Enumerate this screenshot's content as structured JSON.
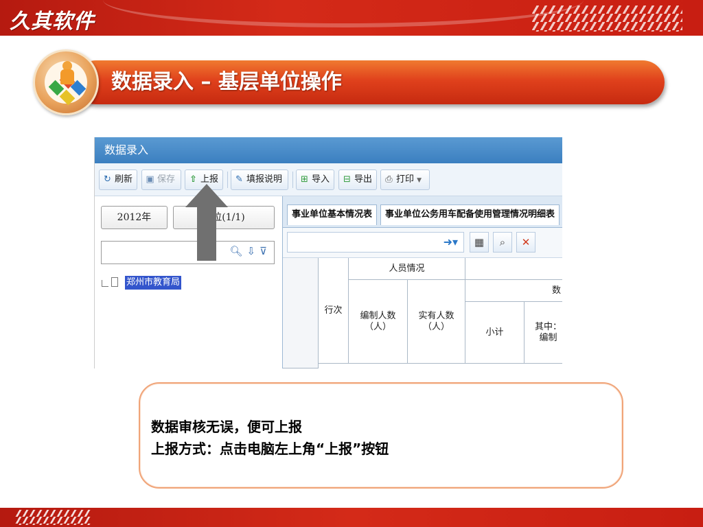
{
  "brand": {
    "logo_text": "久其软件",
    "primary_color": "#c81e12",
    "accent_color": "#e0411c"
  },
  "header": {
    "title": "数据录入 – 基层单位操作",
    "badge_icon": "colored-cubes-person-icon"
  },
  "screenshot": {
    "window_title": "数据录入",
    "toolbar": [
      {
        "label": "刷新",
        "icon": "refresh-icon",
        "enabled": true
      },
      {
        "label": "保存",
        "icon": "save-icon",
        "enabled": false
      },
      {
        "label": "上报",
        "icon": "upload-arrow-icon",
        "enabled": true
      },
      {
        "label": "填报说明",
        "icon": "edit-note-icon",
        "enabled": true
      },
      {
        "label": "导入",
        "icon": "import-icon",
        "enabled": true
      },
      {
        "label": "导出",
        "icon": "export-icon",
        "enabled": true
      },
      {
        "label": "打印",
        "icon": "print-icon",
        "enabled": true
      }
    ],
    "left_panel": {
      "year_button": "2012年",
      "unit_button": "单位(1/1)",
      "search_placeholder": "",
      "tree_item": "郑州市教育局"
    },
    "tabs": [
      {
        "label": "事业单位基本情况表"
      },
      {
        "label": "事业单位公务用车配备使用管理情况明细表"
      }
    ],
    "grid": {
      "header_group_1": "人员情况",
      "header_group_2": "数",
      "col_row_num": "行次",
      "col_staff_quota": "编制人数（人）",
      "col_staff_actual": "实有人数（人）",
      "col_subtotal": "小计",
      "col_other": "其中：编制"
    }
  },
  "note": {
    "line1": "数据审核无误，便可上报",
    "line2": "上报方式：点击电脑左上角“上报”按钮"
  }
}
